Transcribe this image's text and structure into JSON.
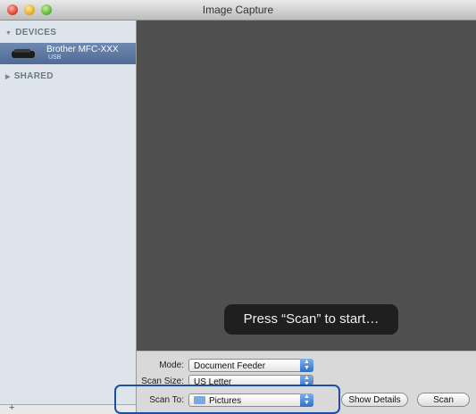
{
  "window": {
    "title": "Image Capture"
  },
  "sidebar": {
    "devices_label": "DEVICES",
    "device": {
      "name": "Brother MFC-XXX",
      "connection": "USB"
    },
    "shared_label": "SHARED",
    "add_label": "+"
  },
  "preview": {
    "message": "Press “Scan” to start…"
  },
  "controls": {
    "mode_label": "Mode:",
    "mode_value": "Document Feeder",
    "scan_size_label": "Scan Size:",
    "scan_size_value": "US Letter",
    "scan_to_label": "Scan To:",
    "scan_to_value": "Pictures",
    "show_details_label": "Show Details",
    "scan_label": "Scan"
  },
  "colors": {
    "highlight": "#1f4fa1",
    "selection": "#5a74a0",
    "preview_bg": "#505050"
  }
}
